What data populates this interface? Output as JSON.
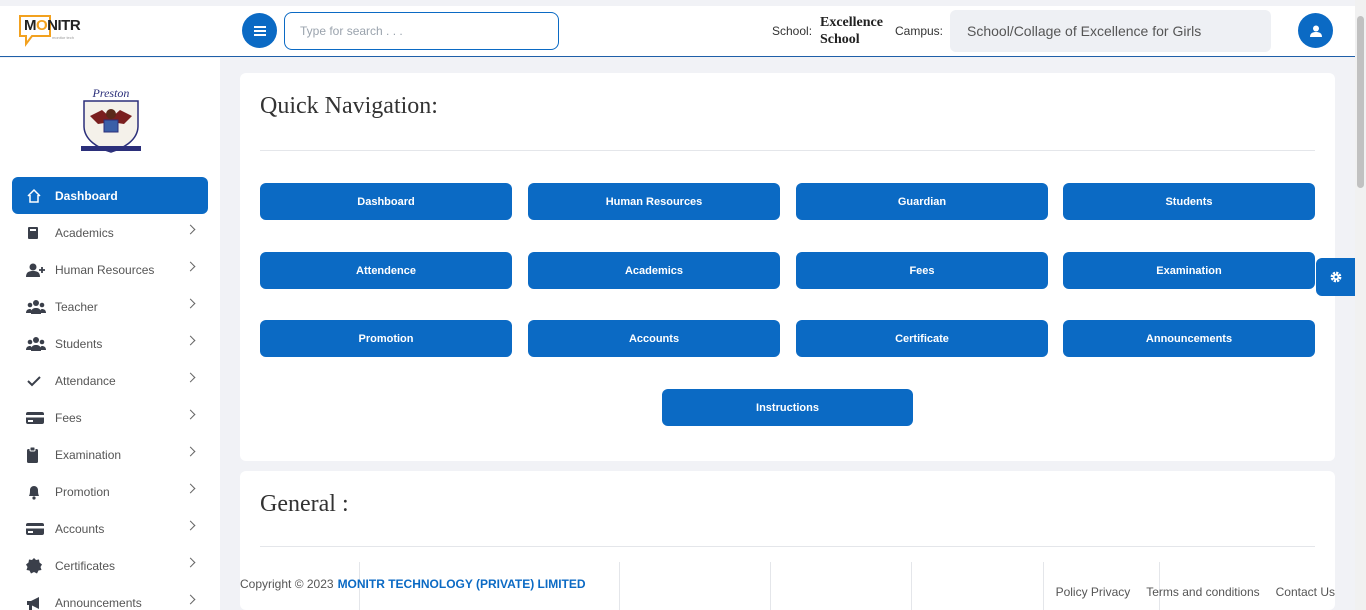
{
  "brand": {
    "logo_text_prefix": "M",
    "logo_text_o": "O",
    "logo_text_suffix": "NITR",
    "logo_subtitle": "monitor tech"
  },
  "header": {
    "search_placeholder": "Type for search . . .",
    "school_label": "School:",
    "school_name": "Excellence School",
    "campus_label": "Campus:",
    "campus_value": "School/Collage of Excellence for Girls"
  },
  "crest": {
    "name": "Preston"
  },
  "sidebar": {
    "items": [
      {
        "label": "Dashboard",
        "icon": "home-icon",
        "active": true
      },
      {
        "label": "Academics",
        "icon": "book-icon"
      },
      {
        "label": "Human Resources",
        "icon": "user-plus-icon"
      },
      {
        "label": "Teacher",
        "icon": "users-icon"
      },
      {
        "label": "Students",
        "icon": "users-icon"
      },
      {
        "label": "Attendance",
        "icon": "check-icon"
      },
      {
        "label": "Fees",
        "icon": "credit-card-icon"
      },
      {
        "label": "Examination",
        "icon": "clipboard-icon"
      },
      {
        "label": "Promotion",
        "icon": "bell-icon"
      },
      {
        "label": "Accounts",
        "icon": "credit-card-icon"
      },
      {
        "label": "Certificates",
        "icon": "certificate-icon"
      },
      {
        "label": "Announcements",
        "icon": "megaphone-icon"
      }
    ]
  },
  "quick_nav": {
    "title": "Quick Navigation:",
    "buttons": [
      "Dashboard",
      "Human Resources",
      "Guardian",
      "Students",
      "Attendence",
      "Academics",
      "Fees",
      "Examination",
      "Promotion",
      "Accounts",
      "Certificate",
      "Announcements",
      "Instructions"
    ]
  },
  "general": {
    "title": "General :"
  },
  "footer": {
    "copyright": "Copyright © 2023",
    "company": "MONITR TECHNOLOGY (PRIVATE) LIMITED",
    "links": [
      "Policy Privacy",
      "Terms and conditions",
      "Contact Us"
    ]
  },
  "colors": {
    "accent": "#0b6ac4",
    "logo_orange": "#f2a11f"
  }
}
